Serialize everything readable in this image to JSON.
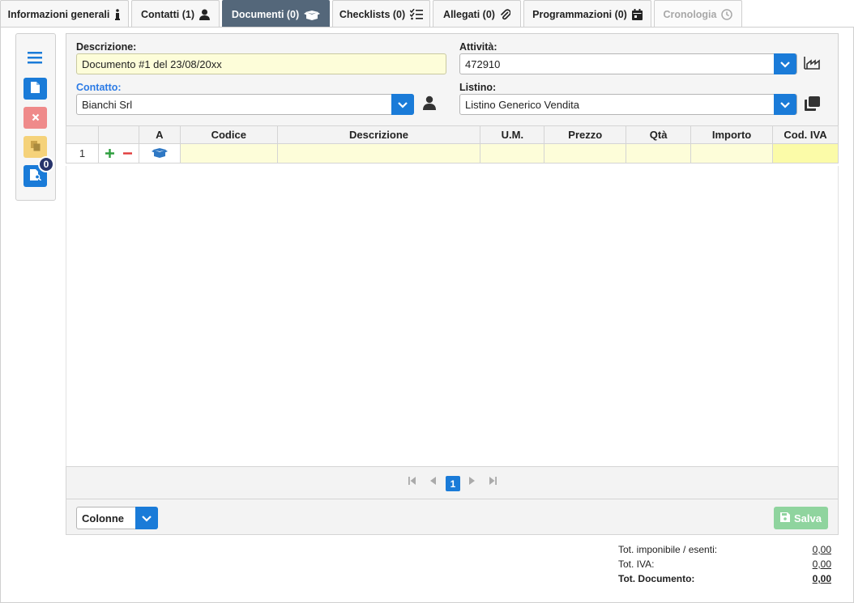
{
  "tabs": [
    {
      "label": "Informazioni generali",
      "icon": "info-icon",
      "state": "normal"
    },
    {
      "label": "Contatti (1)",
      "icon": "user-icon",
      "state": "normal"
    },
    {
      "label": "Documenti (0)",
      "icon": "box-open-icon",
      "state": "active"
    },
    {
      "label": "Checklists (0)",
      "icon": "checklist-icon",
      "state": "normal"
    },
    {
      "label": "Allegati (0)",
      "icon": "paperclip-icon",
      "state": "normal"
    },
    {
      "label": "Programmazioni (0)",
      "icon": "calendar-icon",
      "state": "normal"
    },
    {
      "label": "Cronologia",
      "icon": "clock-icon",
      "state": "disabled"
    }
  ],
  "toolbar": {
    "badge_count": "0"
  },
  "form": {
    "descrizione_label": "Descrizione:",
    "descrizione_value": "Documento #1 del 23/08/20xx",
    "attivita_label": "Attività:",
    "attivita_value": "472910",
    "contatto_label": "Contatto:",
    "contatto_value": "Bianchi Srl",
    "listino_label": "Listino:",
    "listino_value": "Listino Generico Vendita"
  },
  "grid": {
    "headers": [
      "",
      "",
      "A",
      "Codice",
      "Descrizione",
      "U.M.",
      "Prezzo",
      "Qtà",
      "Importo",
      "Cod. IVA"
    ],
    "rows": [
      {
        "num": "1"
      }
    ]
  },
  "pager": {
    "current_page": "1"
  },
  "footer": {
    "columns_label": "Colonne",
    "save_label": "Salva"
  },
  "totals": [
    {
      "label": "Tot. imponibile / esenti:",
      "value": "0,00",
      "bold": false
    },
    {
      "label": "Tot. IVA:",
      "value": "0,00",
      "bold": false
    },
    {
      "label": "Tot. Documento:",
      "value": "0,00",
      "bold": true
    }
  ],
  "colors": {
    "accent": "#1a7bd8",
    "active_tab": "#54677a",
    "danger": "#ef8a8a",
    "warning": "#f5d27a",
    "success": "#8fd49e",
    "badge": "#27346b"
  }
}
